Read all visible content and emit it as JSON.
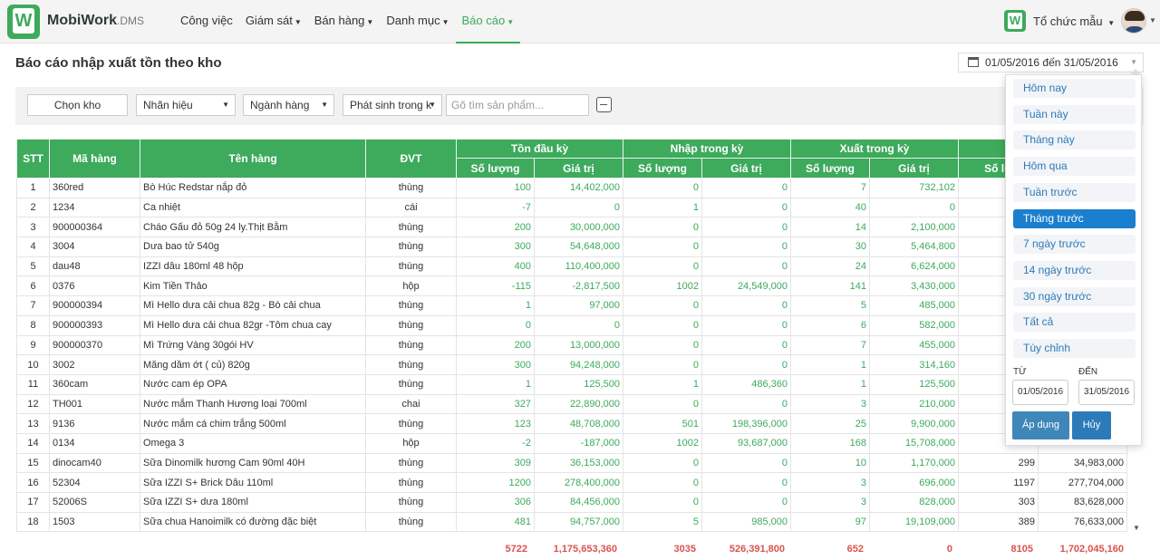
{
  "header": {
    "brand": "MobiWork",
    "brand_suffix": ".DMS",
    "logo_letter": "W",
    "nav": [
      {
        "label": "Công việc",
        "has_caret": false,
        "active": false
      },
      {
        "label": "Giám sát",
        "has_caret": true,
        "active": false
      },
      {
        "label": "Bán hàng",
        "has_caret": true,
        "active": false
      },
      {
        "label": "Danh mục",
        "has_caret": true,
        "active": false
      },
      {
        "label": "Báo cáo",
        "has_caret": true,
        "active": true
      }
    ],
    "org_name": "Tổ chức mẫu"
  },
  "page": {
    "title": "Báo cáo nhập xuất tồn theo kho",
    "date_range": "01/05/2016 đến 31/05/2016"
  },
  "filters": {
    "warehouse_button": "Chọn kho",
    "brand_select": "Nhãn hiệu",
    "category_select": "Ngành hàng",
    "period_select": "Phát sinh trong k",
    "search_placeholder": "Gõ tìm sản phẩm..."
  },
  "table": {
    "headers": {
      "stt": "STT",
      "code": "Mã hàng",
      "name": "Tên hàng",
      "unit": "ĐVT",
      "opening": "Tồn đầu kỳ",
      "import": "Nhập trong kỳ",
      "export": "Xuất trong kỳ",
      "qty": "Số lượng",
      "value": "Giá trị",
      "closing_qty_partial": "Số lư"
    },
    "rows": [
      {
        "stt": "1",
        "code": "360red",
        "name": "Bò Húc Redstar nắp đỏ",
        "unit": "thùng",
        "oq": "100",
        "ov": "14,402,000",
        "iq": "0",
        "iv": "0",
        "eq": "7",
        "ev": "732,102",
        "cq": "",
        "cv": ""
      },
      {
        "stt": "2",
        "code": "1234",
        "name": "Ca nhiệt",
        "unit": "cái",
        "oq": "-7",
        "ov": "0",
        "iq": "1",
        "iv": "0",
        "eq": "40",
        "ev": "0",
        "cq": "",
        "cv": ""
      },
      {
        "stt": "3",
        "code": "900000364",
        "name": "Cháo Gấu đỏ 50g 24 ly.Thịt Bằm",
        "unit": "thùng",
        "oq": "200",
        "ov": "30,000,000",
        "iq": "0",
        "iv": "0",
        "eq": "14",
        "ev": "2,100,000",
        "cq": "",
        "cv": ""
      },
      {
        "stt": "4",
        "code": "3004",
        "name": "Dưa bao tử 540g",
        "unit": "thùng",
        "oq": "300",
        "ov": "54,648,000",
        "iq": "0",
        "iv": "0",
        "eq": "30",
        "ev": "5,464,800",
        "cq": "",
        "cv": ""
      },
      {
        "stt": "5",
        "code": "dau48",
        "name": "IZZI dâu 180ml 48 hộp",
        "unit": "thùng",
        "oq": "400",
        "ov": "110,400,000",
        "iq": "0",
        "iv": "0",
        "eq": "24",
        "ev": "6,624,000",
        "cq": "",
        "cv": ""
      },
      {
        "stt": "6",
        "code": "0376",
        "name": "Kim Tiền Thảo",
        "unit": "hộp",
        "oq": "-115",
        "ov": "-2,817,500",
        "iq": "1002",
        "iv": "24,549,000",
        "eq": "141",
        "ev": "3,430,000",
        "cq": "",
        "cv": ""
      },
      {
        "stt": "7",
        "code": "900000394",
        "name": "Mì Hello dưa cải chua 82g - Bò cải chua",
        "unit": "thùng",
        "oq": "1",
        "ov": "97,000",
        "iq": "0",
        "iv": "0",
        "eq": "5",
        "ev": "485,000",
        "cq": "",
        "cv": ""
      },
      {
        "stt": "8",
        "code": "900000393",
        "name": "Mì Hello dưa cải chua 82gr -Tôm chua cay",
        "unit": "thùng",
        "oq": "0",
        "ov": "0",
        "iq": "0",
        "iv": "0",
        "eq": "6",
        "ev": "582,000",
        "cq": "",
        "cv": ""
      },
      {
        "stt": "9",
        "code": "900000370",
        "name": "Mì Trứng Vàng 30gói HV",
        "unit": "thùng",
        "oq": "200",
        "ov": "13,000,000",
        "iq": "0",
        "iv": "0",
        "eq": "7",
        "ev": "455,000",
        "cq": "",
        "cv": ""
      },
      {
        "stt": "10",
        "code": "3002",
        "name": "Măng dầm ớt ( củ) 820g",
        "unit": "thùng",
        "oq": "300",
        "ov": "94,248,000",
        "iq": "0",
        "iv": "0",
        "eq": "1",
        "ev": "314,160",
        "cq": "",
        "cv": ""
      },
      {
        "stt": "11",
        "code": "360cam",
        "name": "Nước cam ép OPA",
        "unit": "thùng",
        "oq": "1",
        "ov": "125,500",
        "iq": "1",
        "iv": "486,360",
        "eq": "1",
        "ev": "125,500",
        "cq": "",
        "cv": ""
      },
      {
        "stt": "12",
        "code": "TH001",
        "name": "Nước mắm Thanh Hương loại 700ml",
        "unit": "chai",
        "oq": "327",
        "ov": "22,890,000",
        "iq": "0",
        "iv": "0",
        "eq": "3",
        "ev": "210,000",
        "cq": "",
        "cv": ""
      },
      {
        "stt": "13",
        "code": "9136",
        "name": "Nước mắm cá chim trắng 500ml",
        "unit": "thùng",
        "oq": "123",
        "ov": "48,708,000",
        "iq": "501",
        "iv": "198,396,000",
        "eq": "25",
        "ev": "9,900,000",
        "cq": "",
        "cv": ""
      },
      {
        "stt": "14",
        "code": "0134",
        "name": "Omega 3",
        "unit": "hộp",
        "oq": "-2",
        "ov": "-187,000",
        "iq": "1002",
        "iv": "93,687,000",
        "eq": "168",
        "ev": "15,708,000",
        "cq": "",
        "cv": ""
      },
      {
        "stt": "15",
        "code": "dinocam40",
        "name": "Sữa Dinomilk hương Cam 90ml 40H",
        "unit": "thùng",
        "oq": "309",
        "ov": "36,153,000",
        "iq": "0",
        "iv": "0",
        "eq": "10",
        "ev": "1,170,000",
        "cq": "299",
        "cv": "34,983,000"
      },
      {
        "stt": "16",
        "code": "52304",
        "name": "Sữa IZZI S+ Brick Dâu 110ml",
        "unit": "thùng",
        "oq": "1200",
        "ov": "278,400,000",
        "iq": "0",
        "iv": "0",
        "eq": "3",
        "ev": "696,000",
        "cq": "1197",
        "cv": "277,704,000"
      },
      {
        "stt": "17",
        "code": "52006S",
        "name": "Sữa IZZI S+ dưa 180ml",
        "unit": "thùng",
        "oq": "306",
        "ov": "84,456,000",
        "iq": "0",
        "iv": "0",
        "eq": "3",
        "ev": "828,000",
        "cq": "303",
        "cv": "83,628,000"
      },
      {
        "stt": "18",
        "code": "1503",
        "name": "Sữa chua Hanoimilk có đường đặc biệt",
        "unit": "thùng",
        "oq": "481",
        "ov": "94,757,000",
        "iq": "5",
        "iv": "985,000",
        "eq": "97",
        "ev": "19,109,000",
        "cq": "389",
        "cv": "76,633,000"
      }
    ],
    "totals": {
      "oq": "5722",
      "ov": "1,175,653,360",
      "iq": "3035",
      "iv": "526,391,800",
      "eq": "652",
      "ev": "0",
      "cq": "8105",
      "cv": "1,702,045,160"
    }
  },
  "range_picker": {
    "options": [
      {
        "label": "Hôm nay",
        "active": false
      },
      {
        "label": "Tuần này",
        "active": false
      },
      {
        "label": "Tháng này",
        "active": false
      },
      {
        "label": "Hôm qua",
        "active": false
      },
      {
        "label": "Tuần trước",
        "active": false
      },
      {
        "label": "Tháng trước",
        "active": true
      },
      {
        "label": "7 ngày trước",
        "active": false
      },
      {
        "label": "14 ngày trước",
        "active": false
      },
      {
        "label": "30 ngày trước",
        "active": false
      },
      {
        "label": "Tất cả",
        "active": false
      },
      {
        "label": "Tùy chỉnh",
        "active": false
      }
    ],
    "from_label": "TỪ",
    "to_label": "ĐẾN",
    "from_value": "01/05/2016",
    "to_value": "31/05/2016",
    "apply_label": "Áp dụng",
    "cancel_label": "Hủy"
  }
}
